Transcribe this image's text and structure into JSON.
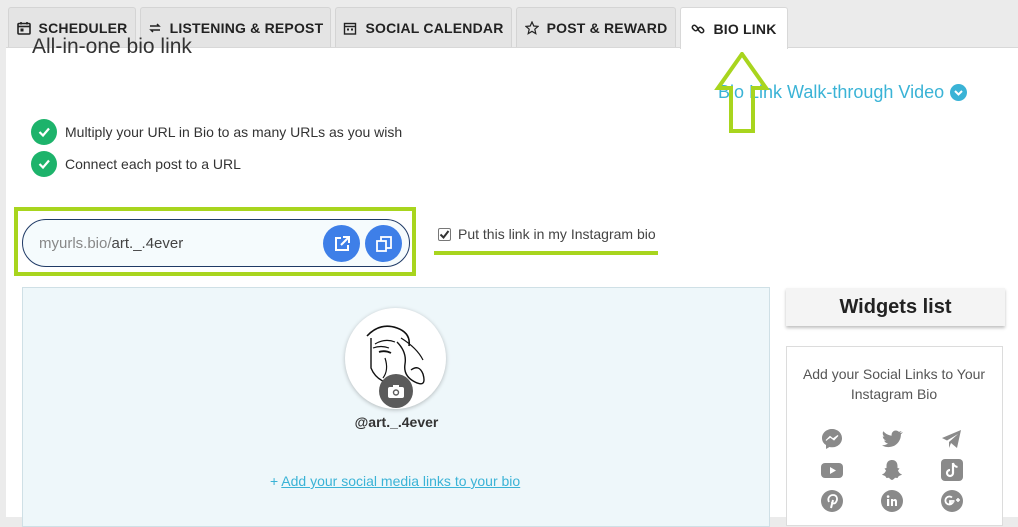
{
  "tabs": [
    {
      "label": "SCHEDULER",
      "icon": "calendar-icon"
    },
    {
      "label": "LISTENING & REPOST",
      "icon": "repost-icon"
    },
    {
      "label": "SOCIAL CALENDAR",
      "icon": "calendar-grid-icon"
    },
    {
      "label": "POST & REWARD",
      "icon": "star-icon"
    },
    {
      "label": "BIO LINK",
      "icon": "link-icon",
      "active": true
    }
  ],
  "main": {
    "title": "All-in-one bio link",
    "walkthrough_link": "Bio Link Walk-through Video",
    "features": [
      "Multiply your URL in Bio to as many URLs as you wish",
      "Connect each post to a URL"
    ],
    "url": {
      "prefix": "myurls.bio/",
      "handle": "art._.4ever"
    },
    "instagram_checkbox": {
      "label": "Put this link in my Instagram bio",
      "checked": true
    }
  },
  "preview": {
    "username": "@art._.4ever",
    "add_social_prefix": "+ ",
    "add_social_link": "Add your social media links to your bio"
  },
  "widgets": {
    "title": "Widgets list",
    "description": "Add your Social Links to Your Instagram Bio",
    "icons": [
      "messenger-icon",
      "twitter-icon",
      "telegram-icon",
      "youtube-icon",
      "snapchat-icon",
      "tiktok-icon",
      "pinterest-icon",
      "linkedin-icon",
      "google-plus-icon"
    ]
  },
  "colors": {
    "accent": "#3ab3d6",
    "highlight": "#a8d51e",
    "check": "#1db36b",
    "button": "#3e7fe8",
    "icon_gray": "#8a8a8a"
  }
}
